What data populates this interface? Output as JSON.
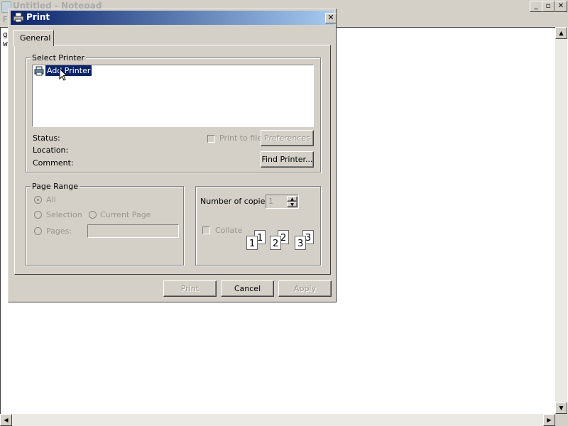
{
  "notepad": {
    "title": "Untitled - Notepad",
    "menu_first": "F",
    "text_lines": [
      "g",
      "w"
    ],
    "buttons": {
      "minimize": "_",
      "maximize": "▫",
      "close": "✕"
    }
  },
  "dialog": {
    "title": "Print",
    "close_glyph": "✕",
    "tab_label": "General",
    "select_printer": {
      "group_label": "Select Printer",
      "items": [
        {
          "label": "Add Printer",
          "selected": true
        }
      ],
      "status_label": "Status:",
      "location_label": "Location:",
      "comment_label": "Comment:",
      "print_to_file_label": "Print to file",
      "print_to_file_checked": false,
      "preferences_label": "Preferences",
      "find_printer_label": "Find Printer..."
    },
    "page_range": {
      "group_label": "Page Range",
      "all_label": "All",
      "selection_label": "Selection",
      "current_page_label": "Current Page",
      "pages_label": "Pages:",
      "pages_value": "",
      "selected": "All"
    },
    "copies": {
      "number_label": "Number of copies:",
      "value": "1",
      "collate_label": "Collate",
      "collate_checked": false,
      "collate_pages": [
        "1",
        "1",
        "2",
        "2",
        "3",
        "3"
      ]
    },
    "footer": {
      "print_label": "Print",
      "cancel_label": "Cancel",
      "apply_label": "Apply"
    }
  },
  "colors": {
    "title_bar_start": "#0a246a",
    "title_bar_end": "#a6caf0",
    "selection": "#0a246a",
    "dialog_face": "#d4d0c8"
  }
}
